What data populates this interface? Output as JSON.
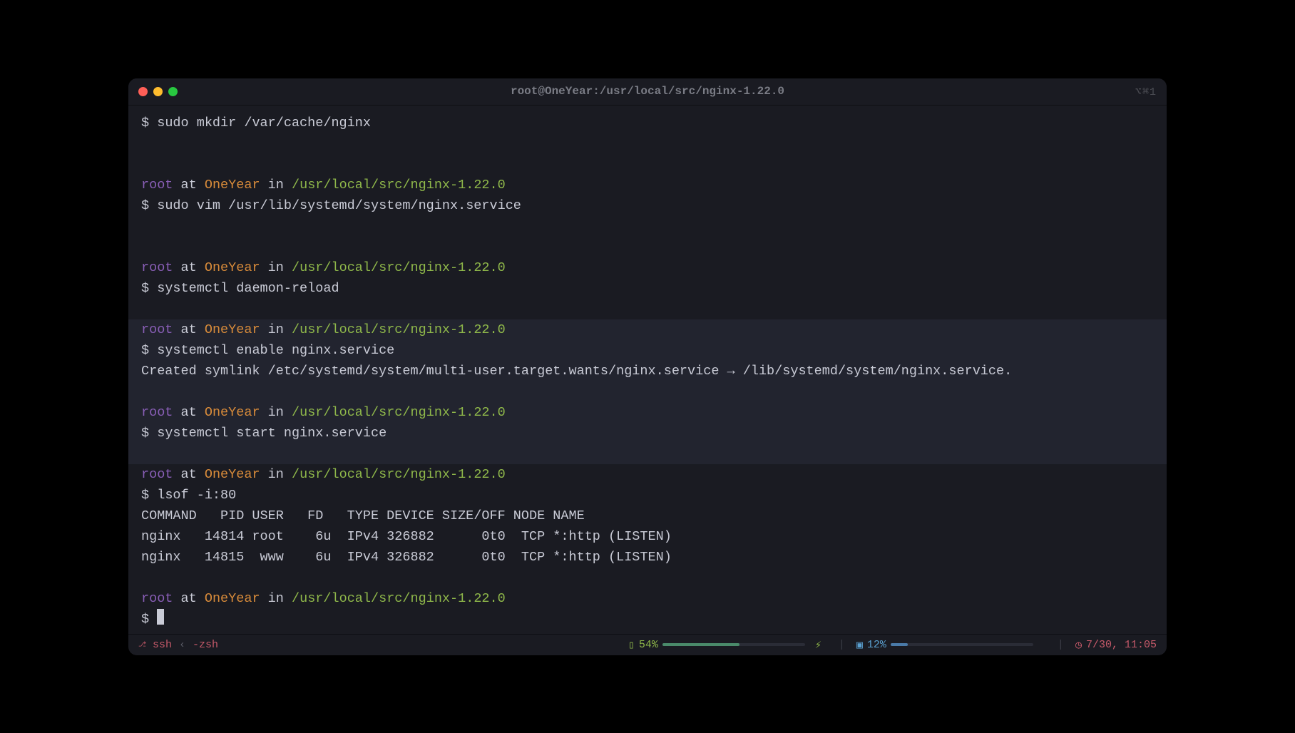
{
  "window": {
    "title": "root@OneYear:/usr/local/src/nginx-1.22.0",
    "right_indicator": "⌥⌘1"
  },
  "prompt": {
    "user": "root",
    "at": " at ",
    "host": "OneYear",
    "in": " in ",
    "path": "/usr/local/src/nginx-1.22.0",
    "symbol": "$ "
  },
  "blocks": [
    {
      "type": "cmd",
      "text": "sudo mkdir /var/cache/nginx"
    },
    {
      "type": "blank"
    },
    {
      "type": "blank"
    },
    {
      "type": "prompt"
    },
    {
      "type": "cmd",
      "text": "sudo vim /usr/lib/systemd/system/nginx.service"
    },
    {
      "type": "blank"
    },
    {
      "type": "blank"
    },
    {
      "type": "prompt"
    },
    {
      "type": "cmd",
      "text": "systemctl daemon-reload"
    },
    {
      "type": "blank"
    },
    {
      "type": "prompt",
      "hl": true
    },
    {
      "type": "cmd",
      "hl": true,
      "text": "systemctl enable nginx.service"
    },
    {
      "type": "out",
      "hl": true,
      "text": "Created symlink /etc/systemd/system/multi-user.target.wants/nginx.service → /lib/systemd/system/nginx.service."
    },
    {
      "type": "blank",
      "hl": true
    },
    {
      "type": "prompt",
      "hl": true
    },
    {
      "type": "cmd",
      "hl": true,
      "text": "systemctl start nginx.service"
    },
    {
      "type": "blank",
      "hl": true
    },
    {
      "type": "prompt",
      "dim": true
    },
    {
      "type": "cmd",
      "text": "lsof -i:80"
    },
    {
      "type": "out",
      "text": "COMMAND   PID USER   FD   TYPE DEVICE SIZE/OFF NODE NAME"
    },
    {
      "type": "out",
      "text": "nginx   14814 root    6u  IPv4 326882      0t0  TCP *:http (LISTEN)"
    },
    {
      "type": "out",
      "text": "nginx   14815  www    6u  IPv4 326882      0t0  TCP *:http (LISTEN)"
    },
    {
      "type": "blank"
    },
    {
      "type": "prompt"
    },
    {
      "type": "cursor"
    }
  ],
  "status": {
    "ssh": "ssh",
    "sep": "‹",
    "shell": "-zsh",
    "battery_pct": "54%",
    "battery_fill": 54,
    "cpu_pct": "12%",
    "cpu_fill": 12,
    "clock": "7/30, 11:05"
  }
}
